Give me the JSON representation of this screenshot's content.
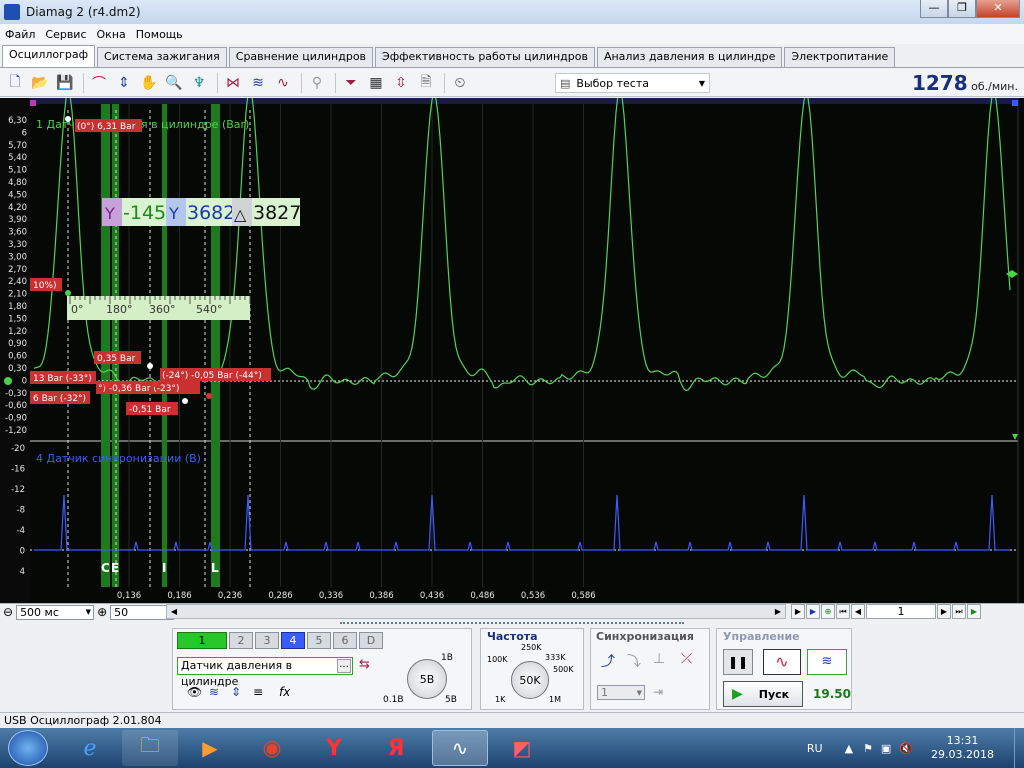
{
  "window": {
    "title": "Diamag 2 (r4.dm2)",
    "controls": [
      "—",
      "❐",
      "✕"
    ]
  },
  "menu": [
    "Файл",
    "Сервис",
    "Окна",
    "Помощь"
  ],
  "tabs": [
    "Осциллограф",
    "Система зажигания",
    "Сравнение цилиндров",
    "Эффективность работы цилиндров",
    "Анализ давления в цилиндре",
    "Электропитание"
  ],
  "toolbar": {
    "test_select": "Выбор теста",
    "rpm_value": "1278",
    "rpm_unit": "об./мин."
  },
  "scope": {
    "channel1_title": "1 Датчик давления в цилиндре (Bar)",
    "channel1_y_ticks": [
      "6,30",
      "6",
      "5,70",
      "5,40",
      "5,10",
      "4,80",
      "4,50",
      "4,20",
      "3,90",
      "3,60",
      "3,30",
      "3,00",
      "2,70",
      "2,40",
      "2,10",
      "1,80",
      "1,50",
      "1,20",
      "0,90",
      "0,60",
      "0,30",
      "0",
      "-0,30",
      "-0,60",
      "-0,90",
      "-1,20"
    ],
    "channel4_title": "4 Датчик синхронизации (В)",
    "channel4_y_ticks": [
      "-20",
      "-16",
      "-12",
      "-8",
      "-4",
      "0",
      "4"
    ],
    "x_ticks": [
      "0,136",
      "0,186",
      "0,236",
      "0,286",
      "0,336",
      "0,386",
      "0,436",
      "0,486",
      "0,536",
      "0,586"
    ],
    "cursor_readout": {
      "c1": "-145",
      "c2": "3682",
      "delta": "3827"
    },
    "angle_scale": [
      "0°",
      "180°",
      "360°",
      "540°"
    ],
    "markers": {
      "peak": "(0°) 6,31 Bar",
      "left_pct": "10%)",
      "m1": "0,35 Bar",
      "m2": "13 Bar (-33°)",
      "m3": "°) -0,36 Bar (-23°)",
      "m4": "(-24°) -0,05 Bar (-44°)",
      "m5": "6 Bar (-32°)",
      "m6": "-0,51 Bar"
    },
    "region_letters": [
      "C",
      "E",
      "I",
      "L"
    ]
  },
  "controls_row": {
    "timebase": "500 мс",
    "zoom": "50",
    "page": "1"
  },
  "bottom": {
    "channels": [
      "1",
      "2",
      "3",
      "4",
      "5",
      "6",
      "D"
    ],
    "sensor": "Датчик давления в цилиндре",
    "volt_knob": "5B",
    "volt_labels": [
      "1B",
      "0.1B",
      "5B"
    ],
    "freq_title": "Частота",
    "freq_knob": "50K",
    "freq_labels": [
      "250K",
      "100K",
      "333K",
      "500K",
      "1K",
      "1M"
    ],
    "sync_title": "Синхронизация",
    "sync_value": "1",
    "control_title": "Управление",
    "start_label": "Пуск",
    "start_value": "19.50"
  },
  "status": {
    "device": "USB Осциллограф  2.01.804"
  },
  "tray": {
    "lang": "RU",
    "time": "13:31",
    "date": "29.03.2018"
  }
}
